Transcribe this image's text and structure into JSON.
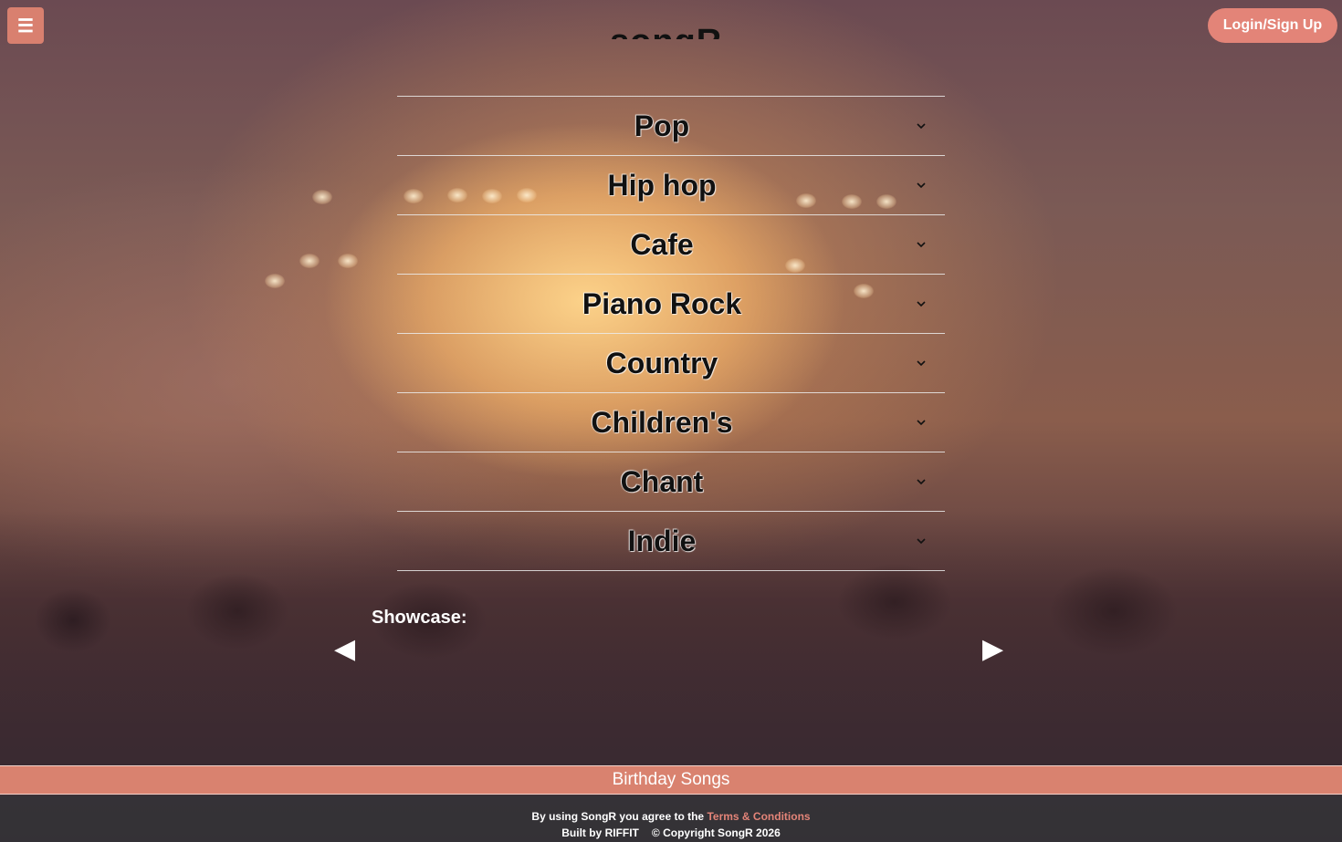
{
  "header": {
    "menu_icon": "☰",
    "logo_text": "songR",
    "login_label": "Login/Sign Up"
  },
  "genres": [
    {
      "label": "Pop"
    },
    {
      "label": "Hip hop"
    },
    {
      "label": "Cafe"
    },
    {
      "label": "Piano Rock"
    },
    {
      "label": "Country"
    },
    {
      "label": "Children's"
    },
    {
      "label": "Chant"
    },
    {
      "label": "Indie"
    }
  ],
  "showcase": {
    "label": "Showcase:",
    "prev_icon": "◀",
    "next_icon": "▶"
  },
  "birthday_bar": {
    "label": "Birthday Songs"
  },
  "footer": {
    "agree_text": "By using SongR you agree to the",
    "terms_link": "Terms & Conditions",
    "built_by": "Built by RIFFIT",
    "copyright": "© Copyright SongR 2026"
  },
  "colors": {
    "accent": "#d9806f",
    "login_button": "#e38478",
    "footer_bg": "#323237"
  }
}
